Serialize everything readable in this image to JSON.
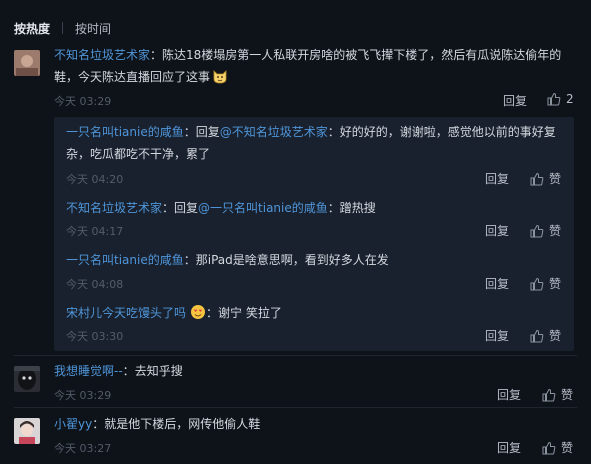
{
  "sort": {
    "active": "按热度",
    "other": "按时间"
  },
  "comments": [
    {
      "user": "不知名垃圾艺术家",
      "sep": "：",
      "text_line1": "陈达18楼塌房第一人私联开房啥的被飞飞撵下楼了，然后有瓜说陈达偷年的",
      "text_line2": "鞋，今天陈达直播回应了这事",
      "time": "今天 03:29",
      "reply": "回复",
      "likes": "2"
    },
    {
      "user": "我想睡觉啊--",
      "sep": "：",
      "text": "去知乎搜",
      "time": "今天 03:29",
      "reply": "回复",
      "like": "赞"
    },
    {
      "user": "小翟yy",
      "sep": "：",
      "text": "就是他下楼后，网传他偷人鞋",
      "time": "今天 03:27",
      "reply": "回复",
      "like": "赞"
    }
  ],
  "replies": [
    {
      "user": "一只名叫tianie的咸鱼",
      "prefix": "：回复",
      "target": "@不知名垃圾艺术家",
      "text_line1": "：好的好的，谢谢啦，感觉他以前的事好复",
      "text_line2": "杂，吃瓜都吃不干净，累了",
      "time": "今天 04:20",
      "reply": "回复",
      "like": "赞"
    },
    {
      "user": "不知名垃圾艺术家",
      "prefix": "：回复",
      "target": "@一只名叫tianie的咸鱼",
      "text": "：蹭热搜",
      "time": "今天 04:17",
      "reply": "回复",
      "like": "赞"
    },
    {
      "user": "一只名叫tianie的咸鱼",
      "sep": "：",
      "text": "那iPad是啥意思啊，看到好多人在发",
      "time": "今天 04:08",
      "reply": "回复",
      "like": "赞"
    },
    {
      "user": "宋村儿今天吃馒头了吗",
      "sep": "：",
      "text": "谢宁 笑拉了",
      "time": "今天 03:30",
      "reply": "回复",
      "like": "赞"
    }
  ],
  "colors": {
    "background": "#0e1219",
    "username": "#4f95d8",
    "reply_box": "#19212e",
    "meta": "#545c69"
  }
}
